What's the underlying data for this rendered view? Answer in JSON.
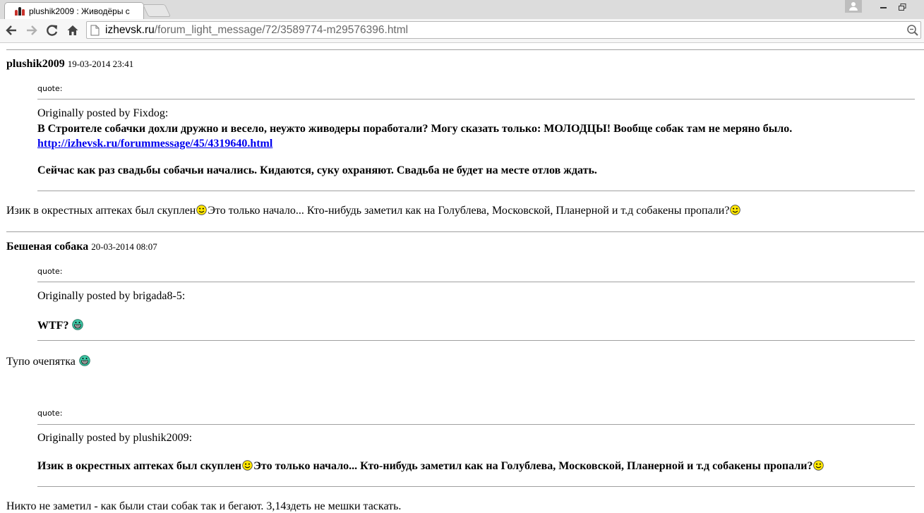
{
  "browser": {
    "tab_title": "plushik2009 : Живодёры с",
    "url_host": "izhevsk.ru",
    "url_path": "/forum_light_message/72/3589774-m29576396.html"
  },
  "posts": [
    {
      "author": "plushik2009",
      "date": "19-03-2014 23:41",
      "quote_label": "quote:",
      "quote_origin": "Originally posted by Fixdog:",
      "quote_line1": "В Строителе собачки дохли дружно и весело, неужто живодеры поработали? Могу сказать только: МОЛОДЦЫ! Вообще собак там не меряно было.",
      "quote_link": "http://izhevsk.ru/forummessage/45/4319640.html",
      "quote_line2": "Сейчас как раз свадьбы собачьи начались. Кидаются, суку охраняют. Свадьба не будет на месте отлов ждать.",
      "body_part1": "Изик в окрестных аптеках был скуплен",
      "body_part2": "Это только начало... Кто-нибудь заметил как на Голублева, Московской, Планерной и т.д собакены пропали?"
    },
    {
      "author": "Бешеная собака",
      "date": "20-03-2014 08:07",
      "quote1_label": "quote:",
      "quote1_origin": "Originally posted by brigada8-5:",
      "quote1_text": "WTF?",
      "body1": "Тупо очепятка",
      "quote2_label": "quote:",
      "quote2_origin": "Originally posted by plushik2009:",
      "quote2_part1": "Изик в окрестных аптеках был скуплен",
      "quote2_part2": "Это только начало... Кто-нибудь заметил как на Голублева, Московской, Планерной и т.д собакены пропали?",
      "body2": "Никто не заметил - как были стаи собак так и бегают. 3,14здеть не мешки таскать."
    }
  ]
}
